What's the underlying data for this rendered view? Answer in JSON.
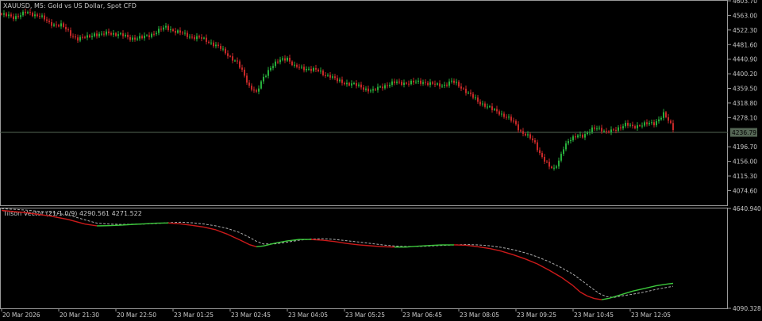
{
  "colors": {
    "background": "#000000",
    "border": "#9a9a9a",
    "text": "#c8c8c8",
    "bull": "#27ae3c",
    "bear": "#c62828",
    "line_up": "#3cc83c",
    "line_down": "#cc1a1a",
    "signal": "#b0b0b0",
    "price_marker": "#556655"
  },
  "chart_data": [
    {
      "type": "candlestick",
      "title": "XAUUSD, M5:  Gold vs US Dollar, Spot CFD",
      "ylim": [
        4033.6,
        4603.7
      ],
      "y_ticks": [
        "4603.70",
        "4563.00",
        "4522.30",
        "4481.60",
        "4440.90",
        "4400.20",
        "4359.50",
        "4318.80",
        "4278.10",
        "4196.70",
        "4156.00",
        "4115.30",
        "4074.60"
      ],
      "current_price": 4236.79,
      "current_price_label": "4236.79",
      "close_path": [
        [
          0,
          4565
        ],
        [
          5,
          4558
        ],
        [
          10,
          4570
        ],
        [
          16,
          4563
        ],
        [
          20,
          4540
        ],
        [
          25,
          4536
        ],
        [
          29,
          4510
        ],
        [
          32,
          4498
        ],
        [
          36,
          4502
        ],
        [
          39,
          4512
        ],
        [
          42,
          4508
        ],
        [
          45,
          4515
        ],
        [
          49,
          4510
        ],
        [
          54,
          4500
        ],
        [
          59,
          4500
        ],
        [
          62,
          4508
        ],
        [
          66,
          4520
        ],
        [
          69,
          4530
        ],
        [
          74,
          4516
        ],
        [
          79,
          4505
        ],
        [
          84,
          4498
        ],
        [
          88,
          4487
        ],
        [
          92,
          4470
        ],
        [
          96,
          4448
        ],
        [
          99,
          4430
        ],
        [
          102,
          4395
        ],
        [
          104,
          4366
        ],
        [
          106,
          4355
        ],
        [
          107,
          4345
        ],
        [
          110,
          4390
        ],
        [
          113,
          4420
        ],
        [
          116,
          4433
        ],
        [
          118,
          4440
        ],
        [
          120,
          4445
        ],
        [
          123,
          4420
        ],
        [
          126,
          4415
        ],
        [
          129,
          4415
        ],
        [
          132,
          4410
        ],
        [
          135,
          4400
        ],
        [
          138,
          4395
        ],
        [
          141,
          4380
        ],
        [
          144,
          4375
        ],
        [
          147,
          4372
        ],
        [
          150,
          4365
        ],
        [
          153,
          4358
        ],
        [
          156,
          4352
        ],
        [
          159,
          4363
        ],
        [
          162,
          4370
        ],
        [
          165,
          4375
        ],
        [
          168,
          4375
        ],
        [
          171,
          4375
        ],
        [
          174,
          4376
        ],
        [
          177,
          4378
        ],
        [
          180,
          4372
        ],
        [
          183,
          4368
        ],
        [
          186,
          4370
        ],
        [
          189,
          4378
        ],
        [
          191,
          4372
        ],
        [
          194,
          4358
        ],
        [
          197,
          4340
        ],
        [
          200,
          4323
        ],
        [
          203,
          4313
        ],
        [
          206,
          4300
        ],
        [
          209,
          4292
        ],
        [
          212,
          4280
        ],
        [
          215,
          4265
        ],
        [
          218,
          4240
        ],
        [
          220,
          4232
        ],
        [
          222,
          4220
        ],
        [
          224,
          4205
        ],
        [
          226,
          4180
        ],
        [
          228,
          4160
        ],
        [
          230,
          4140
        ],
        [
          232,
          4133
        ],
        [
          234,
          4160
        ],
        [
          236,
          4195
        ],
        [
          238,
          4210
        ],
        [
          240,
          4220
        ],
        [
          242,
          4232
        ],
        [
          244,
          4228
        ],
        [
          246,
          4232
        ],
        [
          248,
          4245
        ],
        [
          250,
          4252
        ],
        [
          252,
          4245
        ],
        [
          254,
          4235
        ],
        [
          256,
          4240
        ],
        [
          259,
          4250
        ],
        [
          262,
          4258
        ],
        [
          265,
          4252
        ],
        [
          268,
          4258
        ],
        [
          271,
          4260
        ],
        [
          274,
          4262
        ],
        [
          276,
          4275
        ],
        [
          278,
          4288
        ],
        [
          280,
          4268
        ],
        [
          282,
          4248
        ]
      ]
    },
    {
      "type": "line",
      "title": "Tilson Vector (21/1.0/9) 4290.561 4271.522",
      "ylim": [
        4090.328,
        4640.94
      ],
      "y_ticks": [
        "4640.940",
        "4090.328"
      ],
      "series": [
        {
          "key": "main",
          "values": [
            [
              0,
              4630
            ],
            [
              10,
              4618
            ],
            [
              20,
              4600
            ],
            [
              28,
              4580
            ],
            [
              35,
              4555
            ],
            [
              40,
              4545
            ],
            [
              45,
              4546
            ],
            [
              50,
              4549
            ],
            [
              55,
              4553
            ],
            [
              60,
              4556
            ],
            [
              65,
              4560
            ],
            [
              70,
              4561
            ],
            [
              75,
              4556
            ],
            [
              80,
              4548
            ],
            [
              85,
              4538
            ],
            [
              90,
              4523
            ],
            [
              95,
              4498
            ],
            [
              100,
              4468
            ],
            [
              104,
              4442
            ],
            [
              107,
              4430
            ],
            [
              110,
              4434
            ],
            [
              115,
              4450
            ],
            [
              120,
              4462
            ],
            [
              125,
              4470
            ],
            [
              130,
              4470
            ],
            [
              135,
              4466
            ],
            [
              140,
              4458
            ],
            [
              145,
              4448
            ],
            [
              150,
              4440
            ],
            [
              155,
              4435
            ],
            [
              160,
              4430
            ],
            [
              165,
              4428
            ],
            [
              170,
              4428
            ],
            [
              175,
              4433
            ],
            [
              180,
              4437
            ],
            [
              185,
              4440
            ],
            [
              190,
              4440
            ],
            [
              195,
              4438
            ],
            [
              200,
              4430
            ],
            [
              205,
              4420
            ],
            [
              210,
              4405
            ],
            [
              215,
              4385
            ],
            [
              220,
              4362
            ],
            [
              225,
              4335
            ],
            [
              230,
              4300
            ],
            [
              235,
              4262
            ],
            [
              240,
              4215
            ],
            [
              243,
              4180
            ],
            [
              246,
              4158
            ],
            [
              249,
              4144
            ],
            [
              252,
              4138
            ],
            [
              255,
              4145
            ],
            [
              260,
              4165
            ],
            [
              265,
              4185
            ],
            [
              270,
              4200
            ],
            [
              275,
              4215
            ],
            [
              280,
              4225
            ],
            [
              282,
              4228
            ]
          ]
        },
        {
          "key": "signal",
          "values": [
            [
              0,
              4640
            ],
            [
              10,
              4632
            ],
            [
              20,
              4620
            ],
            [
              28,
              4605
            ],
            [
              35,
              4578
            ],
            [
              40,
              4560
            ],
            [
              45,
              4555
            ],
            [
              50,
              4553
            ],
            [
              55,
              4554
            ],
            [
              60,
              4555
            ],
            [
              65,
              4558
            ],
            [
              70,
              4562
            ],
            [
              75,
              4565
            ],
            [
              80,
              4562
            ],
            [
              85,
              4555
            ],
            [
              90,
              4545
            ],
            [
              95,
              4530
            ],
            [
              100,
              4508
            ],
            [
              104,
              4482
            ],
            [
              107,
              4460
            ],
            [
              110,
              4445
            ],
            [
              115,
              4446
            ],
            [
              120,
              4455
            ],
            [
              125,
              4466
            ],
            [
              130,
              4472
            ],
            [
              135,
              4474
            ],
            [
              140,
              4470
            ],
            [
              145,
              4463
            ],
            [
              150,
              4456
            ],
            [
              155,
              4448
            ],
            [
              160,
              4440
            ],
            [
              165,
              4434
            ],
            [
              170,
              4431
            ],
            [
              175,
              4431
            ],
            [
              180,
              4434
            ],
            [
              185,
              4437
            ],
            [
              190,
              4440
            ],
            [
              195,
              4442
            ],
            [
              200,
              4440
            ],
            [
              205,
              4435
            ],
            [
              210,
              4426
            ],
            [
              215,
              4413
            ],
            [
              220,
              4396
            ],
            [
              225,
              4374
            ],
            [
              230,
              4347
            ],
            [
              235,
              4315
            ],
            [
              240,
              4278
            ],
            [
              244,
              4240
            ],
            [
              248,
              4200
            ],
            [
              251,
              4172
            ],
            [
              254,
              4155
            ],
            [
              257,
              4150
            ],
            [
              260,
              4158
            ],
            [
              265,
              4168
            ],
            [
              270,
              4180
            ],
            [
              275,
              4195
            ],
            [
              280,
              4207
            ],
            [
              282,
              4212
            ]
          ]
        }
      ]
    }
  ],
  "x_axis": {
    "labels": [
      "20 Mar 2026",
      "20 Mar 21:30",
      "20 Mar 22:50",
      "23 Mar 01:25",
      "23 Mar 02:45",
      "23 Mar 04:05",
      "23 Mar 05:25",
      "23 Mar 06:45",
      "23 Mar 08:05",
      "23 Mar 09:25",
      "23 Mar 10:45",
      "23 Mar 12:05"
    ],
    "index_positions": [
      0,
      24,
      48,
      72,
      96,
      120,
      144,
      168,
      192,
      216,
      240,
      264
    ],
    "bar_count": 283
  }
}
